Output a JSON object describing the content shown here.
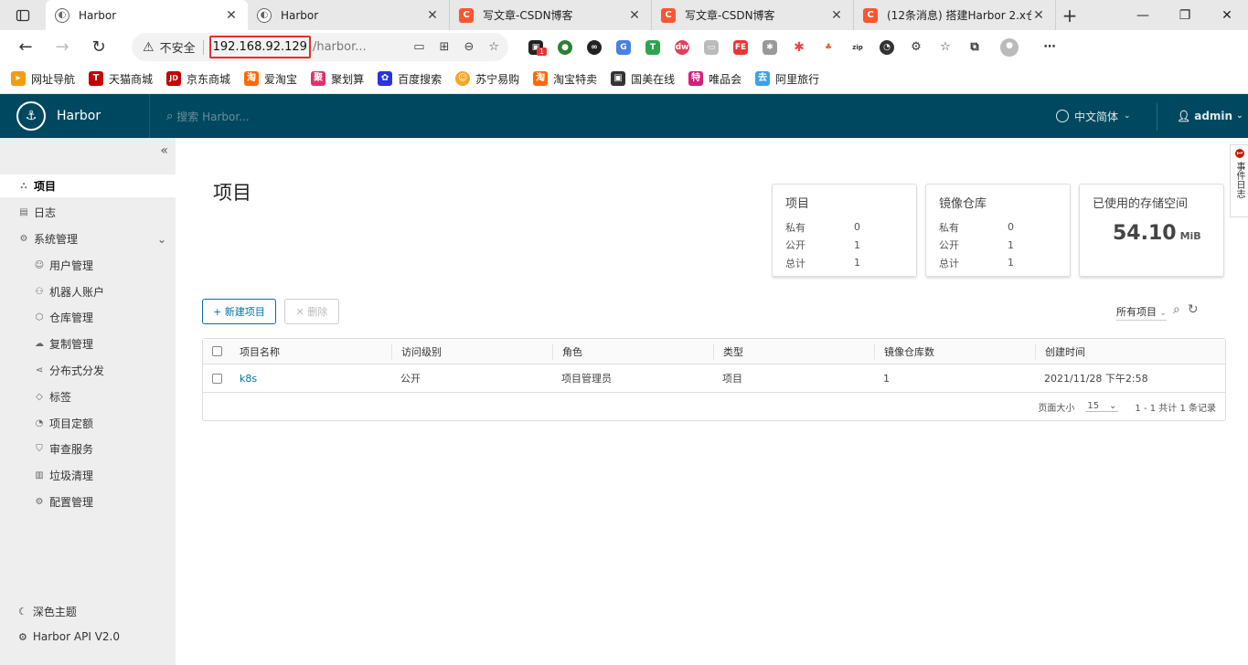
{
  "browser": {
    "tabs": [
      {
        "title": "Harbor",
        "icon": "harbor-icon",
        "active": true
      },
      {
        "title": "Harbor",
        "icon": "harbor-icon",
        "active": false
      },
      {
        "title": "写文章-CSDN博客",
        "icon": "csdn-icon",
        "active": false
      },
      {
        "title": "写文章-CSDN博客",
        "icon": "csdn-icon",
        "active": false
      },
      {
        "title": "(12条消息) 搭建Harbor 2.x仓库",
        "icon": "csdn-icon",
        "active": false
      }
    ],
    "security_label": "不安全",
    "url_host": "192.168.92.129",
    "url_rest": "/harbor...",
    "ext_badge": "1",
    "bookmarks": [
      "网址导航",
      "天猫商城",
      "京东商城",
      "爱淘宝",
      "聚划算",
      "百度搜索",
      "苏宁易购",
      "淘宝特卖",
      "国美在线",
      "唯品会",
      "阿里旅行"
    ]
  },
  "header": {
    "app_name": "Harbor",
    "search_placeholder": "搜索 Harbor...",
    "language": "中文简体",
    "user": "admin"
  },
  "sidebar": {
    "items": [
      {
        "label": "项目",
        "icon": "projects-icon"
      },
      {
        "label": "日志",
        "icon": "logs-icon"
      },
      {
        "label": "系统管理",
        "icon": "admin-icon"
      },
      {
        "label": "用户管理",
        "icon": "users-icon"
      },
      {
        "label": "机器人账户",
        "icon": "robot-icon"
      },
      {
        "label": "仓库管理",
        "icon": "registry-icon"
      },
      {
        "label": "复制管理",
        "icon": "replication-icon"
      },
      {
        "label": "分布式分发",
        "icon": "distribution-icon"
      },
      {
        "label": "标签",
        "icon": "tag-icon"
      },
      {
        "label": "项目定额",
        "icon": "quota-icon"
      },
      {
        "label": "审查服务",
        "icon": "shield-icon"
      },
      {
        "label": "垃圾清理",
        "icon": "trash-icon"
      },
      {
        "label": "配置管理",
        "icon": "gear-icon"
      }
    ],
    "dark_theme": "深色主题",
    "api_version": "Harbor API V2.0"
  },
  "main": {
    "title": "项目",
    "cards": {
      "projects": {
        "title": "项目",
        "rows": [
          {
            "k": "私有",
            "v": "0"
          },
          {
            "k": "公开",
            "v": "1"
          },
          {
            "k": "总计",
            "v": "1"
          }
        ]
      },
      "repos": {
        "title": "镜像仓库",
        "rows": [
          {
            "k": "私有",
            "v": "0"
          },
          {
            "k": "公开",
            "v": "1"
          },
          {
            "k": "总计",
            "v": "1"
          }
        ]
      },
      "storage": {
        "title": "已使用的存储空间",
        "value": "54.10",
        "unit": "MiB"
      }
    },
    "new_project": "+ 新建项目",
    "delete": "✕ 删除",
    "filter": "所有项目",
    "table": {
      "headers": [
        "项目名称",
        "访问级别",
        "角色",
        "类型",
        "镜像仓库数",
        "创建时间"
      ],
      "rows": [
        [
          "k8s",
          "公开",
          "项目管理员",
          "项目",
          "1",
          "2021/11/28 下午2:58"
        ]
      ]
    },
    "page_size_label": "页面大小",
    "page_size": "15",
    "pagination_summary": "1 - 1 共计 1 条记录"
  },
  "event_log_tab": "事件日志",
  "event_log_badge": "1"
}
